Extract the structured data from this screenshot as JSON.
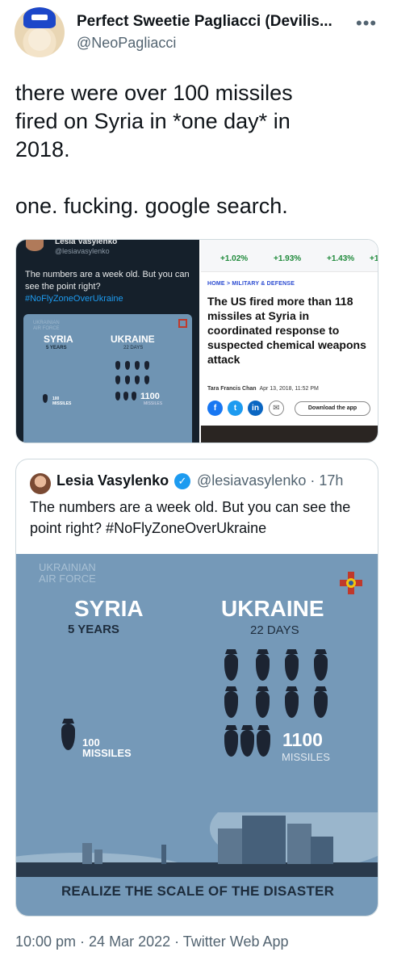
{
  "author": {
    "display_name": "Perfect Sweetie Pagliacci (Devilis...",
    "handle": "@NeoPagliacci",
    "more_icon": "more-horizontal-icon"
  },
  "tweet": {
    "text": "there were over 100 missiles\nfired on Syria in *one day* in\n2018.\n\none. fucking. google search."
  },
  "media_left": {
    "name": "Lesia Vasylenko",
    "handle": "@lesiavasylenko",
    "text": "The numbers are a week old. But you can see the point right?",
    "hashtag": "#NoFlyZoneOverUkraine",
    "poster": {
      "air_force": "UKRAINIAN\nAIR FORCE",
      "syria": "SYRIA",
      "syria_period": "5 YEARS",
      "ukraine": "UKRAINE",
      "ukraine_period": "22 DAYS",
      "syria_count": "100\nMISSILES",
      "ukraine_count": "1100",
      "ukraine_unit": "MISSILES"
    }
  },
  "media_right": {
    "tickers": [
      "+1.02%",
      "+1.93%",
      "+1.43%",
      "+1"
    ],
    "breadcrumb": "HOME > MILITARY & DEFENSE",
    "headline": "The US fired more than 118 missiles at Syria in coordinated response to suspected chemical weapons attack",
    "author": "Tara Francis Chan",
    "date": "Apr 13, 2018, 11:52 PM",
    "download_label": "Download the app",
    "social": [
      "f",
      "t",
      "in",
      "✉"
    ]
  },
  "quote": {
    "name": "Lesia Vasylenko",
    "verified_icon": "verified-badge-icon",
    "handle_time": "@lesiavasylenko · 17h",
    "text": "The numbers are a week old. But you can see the point right? #NoFlyZoneOverUkraine",
    "poster": {
      "air_force": "UKRAINIAN\nAIR FORCE",
      "syria": "SYRIA",
      "syria_period": "5 YEARS",
      "ukraine": "UKRAINE",
      "ukraine_period": "22 DAYS",
      "syria_count": "100\nMISSILES",
      "ukraine_count": "1100",
      "ukraine_unit": "MISSILES",
      "slogan": "REALIZE THE SCALE OF THE DISASTER",
      "colors": {
        "background": "#7599b8",
        "bomb": "#1c2432",
        "crest": "#c0392b"
      }
    }
  },
  "footer": {
    "meta": "10:00 pm · 24 Mar 2022 · Twitter Web App"
  }
}
